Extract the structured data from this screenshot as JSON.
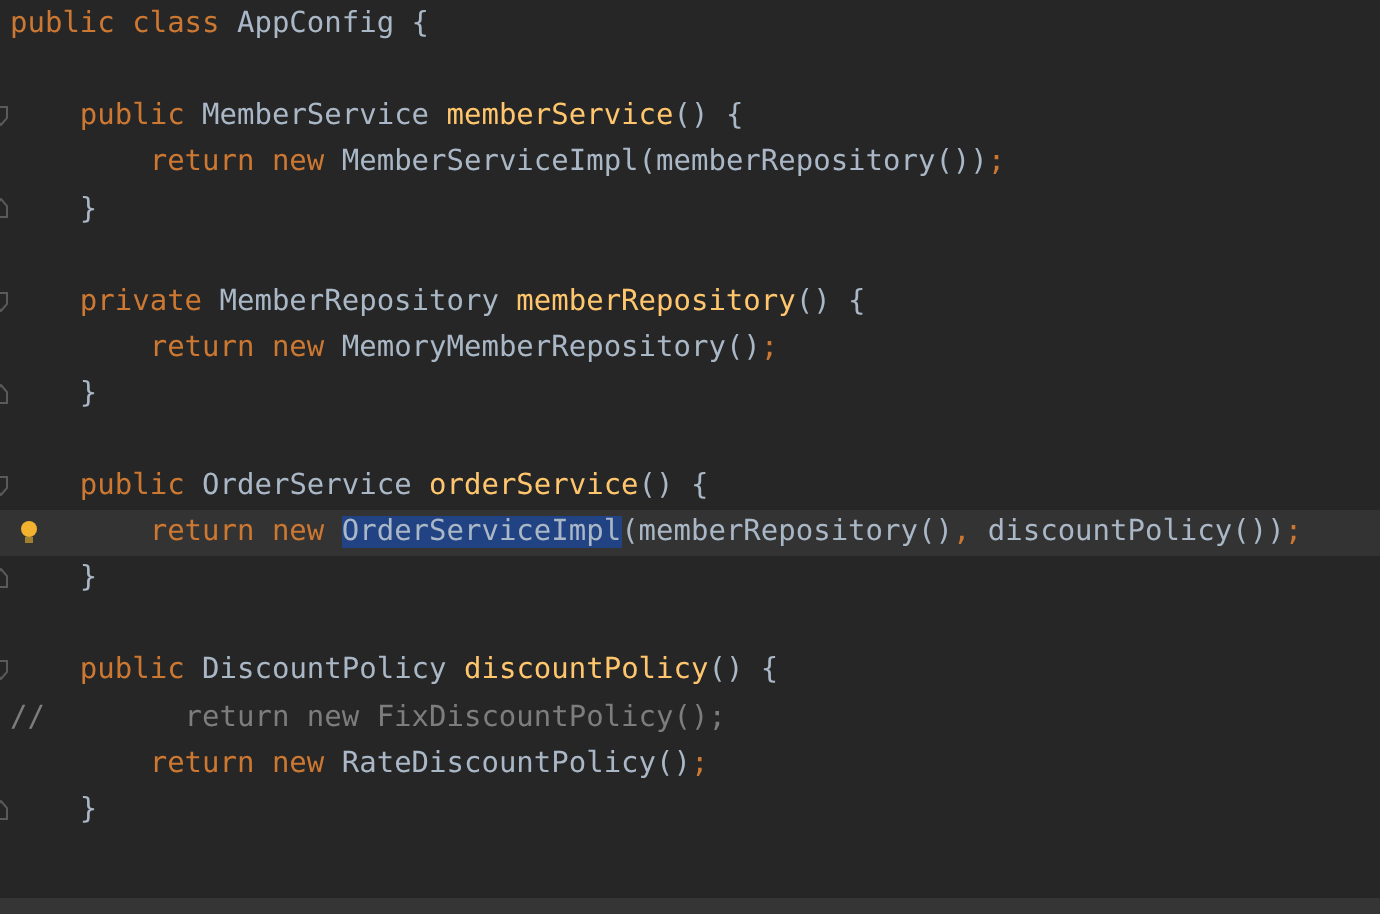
{
  "editor": {
    "header": {
      "tokens": [
        {
          "kind": "keyword",
          "text": "public class",
          "selected": false
        },
        {
          "kind": "text",
          "text": " AppConfig {",
          "selected": false
        }
      ]
    },
    "blocks": [
      {
        "lines": [
          {
            "kind": "fold-start",
            "current": false,
            "tokens": [
              {
                "kind": "keyword",
                "text": "    public",
                "selected": false
              },
              {
                "kind": "text",
                "text": " MemberService ",
                "selected": false
              },
              {
                "kind": "declaration",
                "text": "memberService",
                "selected": false
              },
              {
                "kind": "text",
                "text": "() {",
                "selected": false
              }
            ]
          },
          {
            "kind": "plain",
            "current": false,
            "tokens": [
              {
                "kind": "keyword",
                "text": "        return new",
                "selected": false
              },
              {
                "kind": "text",
                "text": " MemberServiceImpl(memberRepository())",
                "selected": false
              },
              {
                "kind": "punct",
                "text": ";",
                "selected": false
              }
            ]
          },
          {
            "kind": "fold-end",
            "current": false,
            "tokens": [
              {
                "kind": "text",
                "text": "    }",
                "selected": false
              }
            ]
          }
        ]
      },
      {
        "lines": [
          {
            "kind": "fold-start",
            "current": false,
            "tokens": [
              {
                "kind": "keyword",
                "text": "    private",
                "selected": false
              },
              {
                "kind": "text",
                "text": " MemberRepository ",
                "selected": false
              },
              {
                "kind": "declaration",
                "text": "memberRepository",
                "selected": false
              },
              {
                "kind": "text",
                "text": "() {",
                "selected": false
              }
            ]
          },
          {
            "kind": "plain",
            "current": false,
            "tokens": [
              {
                "kind": "keyword",
                "text": "        return new",
                "selected": false
              },
              {
                "kind": "text",
                "text": " MemoryMemberRepository()",
                "selected": false
              },
              {
                "kind": "punct",
                "text": ";",
                "selected": false
              }
            ]
          },
          {
            "kind": "fold-end",
            "current": false,
            "tokens": [
              {
                "kind": "text",
                "text": "    }",
                "selected": false
              }
            ]
          }
        ]
      },
      {
        "lines": [
          {
            "kind": "fold-start",
            "current": false,
            "tokens": [
              {
                "kind": "keyword",
                "text": "    public",
                "selected": false
              },
              {
                "kind": "text",
                "text": " OrderService ",
                "selected": false
              },
              {
                "kind": "declaration",
                "text": "orderService",
                "selected": false
              },
              {
                "kind": "text",
                "text": "() {",
                "selected": false
              }
            ]
          },
          {
            "kind": "bulb",
            "current": true,
            "tokens": [
              {
                "kind": "keyword",
                "text": "        return new ",
                "selected": false
              },
              {
                "kind": "text",
                "text": "OrderServiceImpl",
                "selected": true
              },
              {
                "kind": "text",
                "text": "(memberRepository()",
                "selected": false
              },
              {
                "kind": "punct",
                "text": ",",
                "selected": false
              },
              {
                "kind": "text",
                "text": " discountPolicy())",
                "selected": false
              },
              {
                "kind": "punct",
                "text": ";",
                "selected": false
              }
            ]
          },
          {
            "kind": "fold-end",
            "current": false,
            "tokens": [
              {
                "kind": "text",
                "text": "    }",
                "selected": false
              }
            ]
          }
        ]
      },
      {
        "lines": [
          {
            "kind": "fold-start",
            "current": false,
            "tokens": [
              {
                "kind": "keyword",
                "text": "    public",
                "selected": false
              },
              {
                "kind": "text",
                "text": " DiscountPolicy ",
                "selected": false
              },
              {
                "kind": "declaration",
                "text": "discountPolicy",
                "selected": false
              },
              {
                "kind": "text",
                "text": "() {",
                "selected": false
              }
            ]
          },
          {
            "kind": "plain",
            "current": false,
            "tokens": [
              {
                "kind": "comment",
                "text": "//        return new FixDiscountPolicy();",
                "selected": false
              }
            ]
          },
          {
            "kind": "plain",
            "current": false,
            "tokens": [
              {
                "kind": "keyword",
                "text": "        return new",
                "selected": false
              },
              {
                "kind": "text",
                "text": " RateDiscountPolicy()",
                "selected": false
              },
              {
                "kind": "punct",
                "text": ";",
                "selected": false
              }
            ]
          },
          {
            "kind": "fold-end",
            "current": false,
            "tokens": [
              {
                "kind": "text",
                "text": "    }",
                "selected": false
              }
            ]
          }
        ]
      }
    ]
  }
}
